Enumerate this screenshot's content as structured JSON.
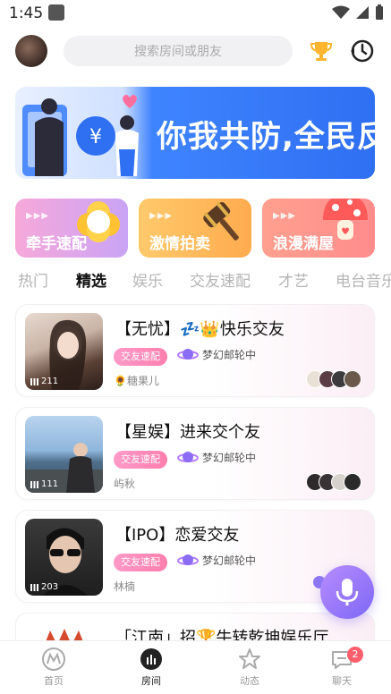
{
  "status_bar": {
    "time": "1:45"
  },
  "header": {
    "search_placeholder": "搜索房间或朋友"
  },
  "banner": {
    "text": "你我共防,全民反诈"
  },
  "feature_cards": [
    {
      "label": "牵手速配"
    },
    {
      "label": "激情拍卖"
    },
    {
      "label": "浪漫满屋"
    }
  ],
  "tabs": [
    {
      "label": "热门"
    },
    {
      "label": "精选"
    },
    {
      "label": "娱乐"
    },
    {
      "label": "交友速配"
    },
    {
      "label": "才艺"
    },
    {
      "label": "电台音乐"
    }
  ],
  "rooms": [
    {
      "title": "【无忧】💤👑快乐交友",
      "tag": "交友速配",
      "status": "梦幻邮轮中",
      "host": "🌻糖果儿",
      "count": "211"
    },
    {
      "title": "【星娱】进来交个友",
      "tag": "交友速配",
      "status": "梦幻邮轮中",
      "host": "屿秋",
      "count": "111"
    },
    {
      "title": "【IPO】恋爱交友",
      "tag": "交友速配",
      "status": "梦幻邮轮中",
      "host": "林楠",
      "count": "203"
    },
    {
      "title": "「江南」招🏆牛转乾坤娱乐厅"
    }
  ],
  "bottom_nav": [
    {
      "label": "首页"
    },
    {
      "label": "房间"
    },
    {
      "label": "动态"
    },
    {
      "label": "聊天",
      "badge": "2"
    }
  ],
  "colors": {
    "accent_pink": "#ff7fae",
    "banner_blue": "#2f6ff2",
    "mic_purple": "#7d68f5",
    "badge_red": "#ff5f6d"
  }
}
